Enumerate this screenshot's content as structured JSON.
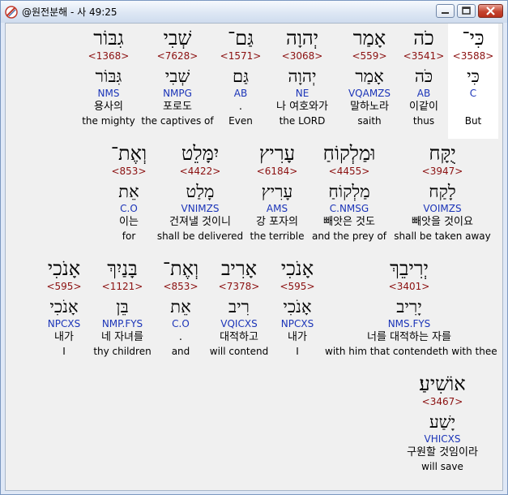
{
  "window": {
    "title": "@원전분해 - 사 49:25"
  },
  "rows": [
    [
      {
        "heb": "כִּי־",
        "num": "<3588>",
        "lemma": "כִּי",
        "morph": "C",
        "kor": "",
        "eng": "But",
        "highlight": true
      },
      {
        "heb": "כֹה",
        "num": "<3541>",
        "lemma": "כֹּה",
        "morph": "AB",
        "kor": "이같이",
        "eng": "thus"
      },
      {
        "heb": "אָמַר",
        "num": "<559>",
        "lemma": "אָמַר",
        "morph": "VQAMZS",
        "kor": "말하노라",
        "eng": "saith"
      },
      {
        "heb": "יְהוָה",
        "num": "<3068>",
        "lemma": "יְהוָה",
        "morph": "NE",
        "kor": "나 여호와가",
        "eng": "the LORD"
      },
      {
        "heb": "גַּם־",
        "num": "<1571>",
        "lemma": "גַּם",
        "morph": "AB",
        "kor": ".",
        "eng": "Even"
      },
      {
        "heb": "שְׁבִי",
        "num": "<7628>",
        "lemma": "שְׁבִי",
        "morph": "NMPG",
        "kor": "포로도",
        "eng": "the captives of"
      },
      {
        "heb": "גִבּוֹר",
        "num": "<1368>",
        "lemma": "גִּבּוֹר",
        "morph": "NMS",
        "kor": "용사의",
        "eng": "the mighty"
      }
    ],
    [
      {
        "heb": "יֻקָּח",
        "num": "<3947>",
        "lemma": "לָקַח",
        "morph": "VOIMZS",
        "kor": "빼앗을 것이요",
        "eng": "shall be taken away"
      },
      {
        "heb": "וּמַלְקוֹחַ",
        "num": "<4455>",
        "lemma": "מַלְקוֹחַ",
        "morph": "C.NMSG",
        "kor": "빼앗은 것도",
        "eng": "and the prey of"
      },
      {
        "heb": "עָרִיץ",
        "num": "<6184>",
        "lemma": "עָרִיץ",
        "morph": "AMS",
        "kor": "강 포자의",
        "eng": "the terrible"
      },
      {
        "heb": "יִמָּלֵט",
        "num": "<4422>",
        "lemma": "מָלַט",
        "morph": "VNIMZS",
        "kor": "건져낼 것이니",
        "eng": "shall be delivered"
      },
      {
        "heb": "וְאֶת־",
        "num": "<853>",
        "lemma": "אֵת",
        "morph": "C.O",
        "kor": "이는",
        "eng": "for"
      }
    ],
    [
      {
        "heb": "יְרִיבֵךְ",
        "num": "<3401>",
        "lemma": "יָרִיב",
        "morph": "NMS.FYS",
        "kor": "너를 대적하는 자를",
        "eng": "with him that contendeth with thee"
      },
      {
        "heb": "אָנֹכִי",
        "num": "<595>",
        "lemma": "אָנֹכִי",
        "morph": "NPCXS",
        "kor": "내가",
        "eng": "I"
      },
      {
        "heb": "אָרִיב",
        "num": "<7378>",
        "lemma": "רִיב",
        "morph": "VQICXS",
        "kor": "대적하고",
        "eng": "will contend"
      },
      {
        "heb": "וְאֶת־",
        "num": "<853>",
        "lemma": "אֵת",
        "morph": "C.O",
        "kor": ".",
        "eng": "and"
      },
      {
        "heb": "בָּנַיִךְ",
        "num": "<1121>",
        "lemma": "בֵּן",
        "morph": "NMP.FYS",
        "kor": "네 자녀를",
        "eng": "thy children"
      },
      {
        "heb": "אָנֹכִי",
        "num": "<595>",
        "lemma": "אָנֹכִי",
        "morph": "NPCXS",
        "kor": "내가",
        "eng": "I"
      }
    ],
    [
      {
        "heb": "אוֹשִׁיעַ׃",
        "num": "<3467>",
        "lemma": "יָשַׁע",
        "morph": "VHICXS",
        "kor": "구원할 것임이라",
        "eng": "will save"
      }
    ]
  ]
}
